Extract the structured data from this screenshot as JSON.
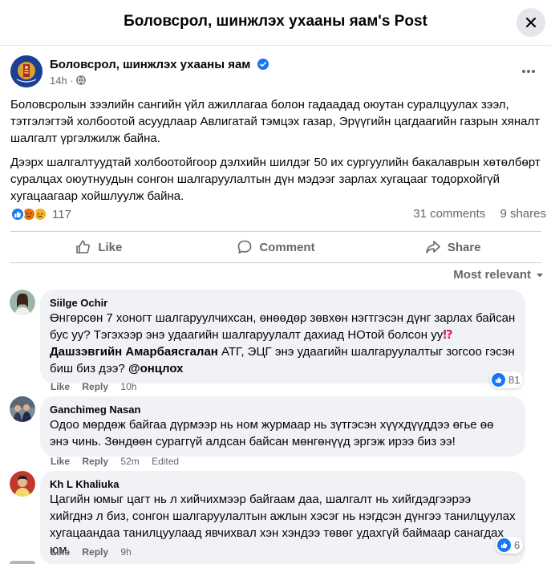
{
  "dialog": {
    "title": "Боловсрол, шинжлэх ухааны яам's Post",
    "close_icon": "close-icon"
  },
  "post": {
    "page_name": "Боловсрол, шинжлэх ухааны яам",
    "time": "14h",
    "audience_icon": "globe-icon",
    "paragraph_1": "Боловсролын зээлийн сангийн үйл ажиллагаа болон гадаадад оюутан суралцуулах зээл, тэтгэлэгтэй холбоотой асуудлаар  Авлигатай тэмцэх газар, Эрүүгийн цагдаагийн газрын хяналт шалгалт үргэлжилж байна.",
    "paragraph_2": "Дээрх шалгалтуудтай холбоотойгоор дэлхийн шилдэг 50 их сургуулийн бакалаврын хөтөлбөрт суралцах оюутнуудын сонгон шалгаруулалтын дүн мэдээг зарлах хугацааг тодорхойгүй хугацаагаар хойшлуулж байна.",
    "reaction_count": "117",
    "comments_count": "31 comments",
    "shares_count": "9 shares",
    "reaction_icons": [
      "like-icon",
      "angry-icon",
      "sad-icon"
    ]
  },
  "actions": {
    "like": "Like",
    "comment": "Comment",
    "share": "Share"
  },
  "sort_label": "Most relevant",
  "comments": [
    {
      "author": "Siilge Ochir",
      "text_1": "Өнгөрсөн 7 хоногт шалгаруулчихсан, өнөөдөр зөвхөн нэгтгэсэн дүнг зарлах байсан бус уу? Тэгэхээр энэ удаагийн шалгаруулалт дахиад НОтой болсон уу",
      "emoji": "⁉",
      "mention_1": "Дашзэвгийн Амарбаясгалан",
      "text_2": " АТГ, ЭЦГ энэ удаагийн шалгаруулалтыг зогсоо гэсэн биш биз дээ? ",
      "mention_2": "@онцлох",
      "like": "Like",
      "reply": "Reply",
      "time": "10h",
      "reactions": "81"
    },
    {
      "author": "Ganchimeg Nasan",
      "text": "Одоо мөрдөж байгаа дүрмээр нь ном журмаар нь зүтгэсэн хүүхдүүддээ өгье өө энэ чинь. Зөндөөн сураггүй алдсан байсан мөнгөнүүд эргэж ирээ биз ээ!",
      "like": "Like",
      "reply": "Reply",
      "time": "52m",
      "edited": "Edited"
    },
    {
      "author": "Kh L Khaliuka",
      "text": "Цагийн юмыг цагт нь л хийчихмээр байгаам даа, шалгалт нь хийгдэдгээрээ хийгднэ л биз, сонгон шалгаруулалтын ажлын хэсэг нь нэгдсэн дүнгээ танилцуулах хугацаандаа танилцуулаад явчихвал хэн хэндээ төвөг удахгүй баймаар санагдах юм.",
      "like": "Like",
      "reply": "Reply",
      "time": "9h",
      "reactions": "6"
    }
  ],
  "colors": {
    "accent": "#1877f2",
    "secondary_text": "#65676b",
    "bubble": "#f0f2f5",
    "emoji_red": "#e0245e"
  }
}
